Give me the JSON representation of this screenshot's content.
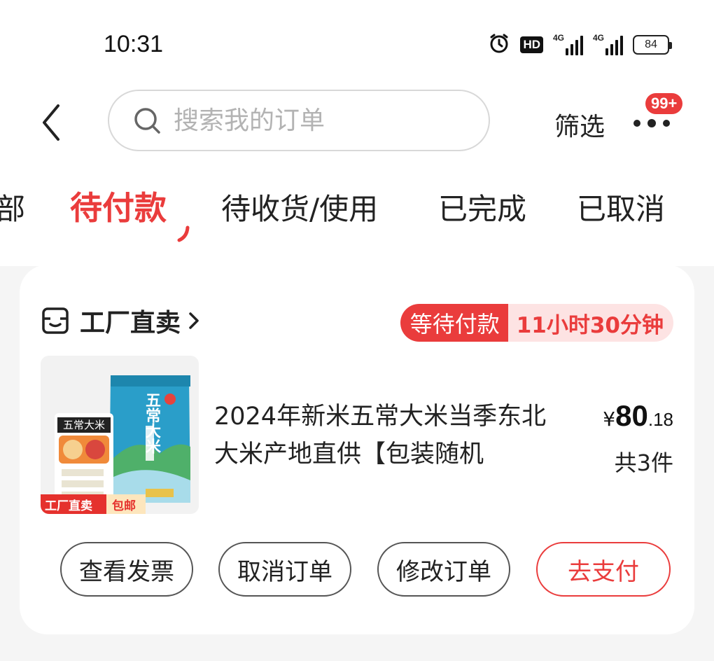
{
  "status_bar": {
    "time": "10:31",
    "hd_label": "HD",
    "signal1_label": "4G",
    "signal2_label": "4G",
    "battery": "84"
  },
  "header": {
    "search_placeholder": "搜索我的订单",
    "filter_label": "筛选",
    "more_badge": "99+",
    "icons": {
      "back": "chevron-left-icon",
      "search": "search-icon",
      "more": "more-dots-icon"
    }
  },
  "tabs": [
    {
      "label": "部",
      "active": false
    },
    {
      "label": "待付款",
      "active": true
    },
    {
      "label": "待收货/使用",
      "active": false
    },
    {
      "label": "已完成",
      "active": false
    },
    {
      "label": "已取消",
      "active": false
    }
  ],
  "order": {
    "store_name": "工厂直卖",
    "status_label": "等待付款",
    "countdown": "11小时30分钟",
    "product": {
      "title": "2024年新米五常大米当季东北大米产地直供【包装随机",
      "image_text": {
        "bag_title": "五常大米",
        "side_label": "五常大米",
        "tag_factory": "工厂直卖",
        "tag_shipping": "包邮"
      },
      "price_currency": "¥",
      "price_int": "80",
      "price_dec": ".18",
      "quantity": "共3件"
    },
    "actions": [
      {
        "label": "查看发票",
        "primary": false
      },
      {
        "label": "取消订单",
        "primary": false
      },
      {
        "label": "修改订单",
        "primary": false
      },
      {
        "label": "去支付",
        "primary": true
      }
    ]
  },
  "colors": {
    "accent": "#ea3c3c",
    "accent_light": "#fde3e3",
    "background": "#f5f5f5",
    "card": "#ffffff"
  }
}
